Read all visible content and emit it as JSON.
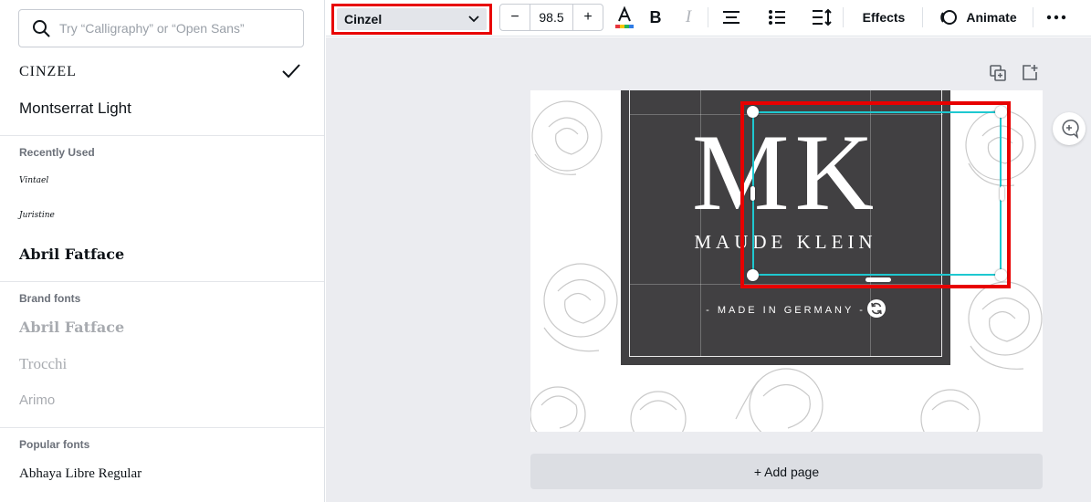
{
  "colors": {
    "selection_red": "#e80000",
    "selection_cyan": "#1ec8d0",
    "label_bg": "#414042",
    "workspace_bg": "#ebecf0"
  },
  "search": {
    "placeholder": "Try “Calligraphy” or “Open Sans”",
    "value": ""
  },
  "fonts": {
    "current": [
      {
        "label": "CINZEL",
        "selected": true
      },
      {
        "label": "Montserrat Light",
        "selected": false
      }
    ],
    "recently_used": {
      "header": "Recently Used",
      "items": [
        "Vintael",
        "Juristine",
        "Abril Fatface"
      ]
    },
    "brand_fonts": {
      "header": "Brand fonts",
      "items": [
        "Abril Fatface",
        "Trocchi",
        "Arimo"
      ]
    },
    "popular_fonts": {
      "header": "Popular fonts",
      "items": [
        "Abhaya Libre Regular"
      ]
    }
  },
  "toolbar": {
    "font_name": "Cinzel",
    "decrease_label": "−",
    "font_size": "98.5",
    "increase_label": "+",
    "bold_label": "B",
    "italic_label": "I",
    "effects_label": "Effects",
    "animate_label": "Animate",
    "icons": [
      "text-color-icon",
      "bold-icon",
      "italic-icon",
      "align-center-icon",
      "list-icon",
      "line-spacing-icon",
      "animate-icon",
      "more-icon"
    ]
  },
  "design": {
    "monogram": "MK",
    "name": "MAUDE KLEIN",
    "tagline": "- MADE IN GERMANY -"
  },
  "add_page_label": "+ Add page"
}
